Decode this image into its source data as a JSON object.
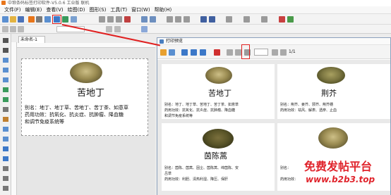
{
  "app": {
    "title": "中琅条码标签打印软件-V5.0.6 工业版 联机"
  },
  "menu": {
    "items": [
      "文件(F)",
      "编辑(E)",
      "查看(V)",
      "绘图(D)",
      "图形(S)",
      "工具(T)",
      "窗口(W)",
      "帮助(H)"
    ]
  },
  "document": {
    "tab_label": "未命名-1",
    "label": {
      "name": "苦地丁",
      "line1": "别名：地丁、地丁草、苦地丁、苦丁茶、如意草",
      "line2": "药用功效：抗氧化、抗炎症、抗肿瘤、降血糖",
      "line3": "和调节免疫系统等"
    }
  },
  "preview": {
    "window_title": "打印预览",
    "page_current": "",
    "page_total": "1/1",
    "cards": [
      {
        "name": "苦地丁",
        "line1": "别名：地丁、地丁草、苦地丁、苦丁茶、如意草",
        "line2": "药用功效：抗氧化、抗炎症、抗肿瘤、降血糖",
        "line3": "和调节免疫系统等"
      },
      {
        "name": "荆芥",
        "line1": "别名：荆芥、姜芥、邪芥、荆芥穗",
        "line2": "药用功效：祛风、解表、透疹、止血"
      },
      {
        "name": "茵陈蒿",
        "line1": "别名：茵陈、茵蒿、因尘、茵陈蒿、绵茵陈、安",
        "line2": "吕草",
        "line3": "药用功效：利胆、清热利湿、降压、保肝"
      },
      {
        "name": "",
        "line1": "别名：",
        "line2": "药用功效："
      }
    ]
  },
  "watermark": {
    "text_cn": "免费发帖平台",
    "text_url": "www.b2b3.top"
  },
  "colors": {
    "highlight": "#e02020",
    "watermark": "#e0242c"
  }
}
